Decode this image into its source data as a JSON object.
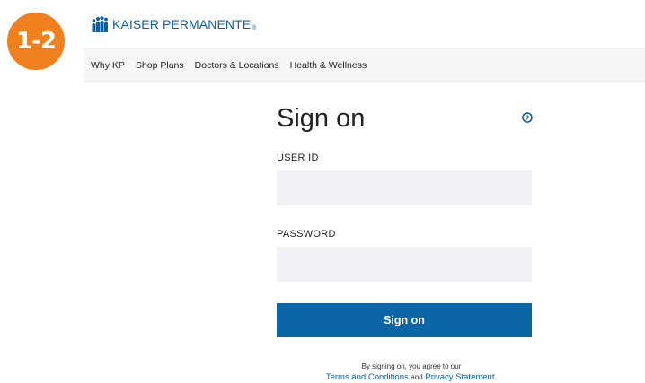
{
  "badge": {
    "step_label": "1-2"
  },
  "brand": {
    "name": "KAISER PERMANENTE",
    "registered_mark": "®",
    "color": "#0b5fa4"
  },
  "nav": {
    "items": [
      {
        "label": "Why KP"
      },
      {
        "label": "Shop Plans"
      },
      {
        "label": "Doctors & Locations"
      },
      {
        "label": "Health & Wellness"
      }
    ]
  },
  "signin": {
    "title": "Sign on",
    "help_icon": "question-circle-icon",
    "user_id_label": "USER ID",
    "user_id_value": "",
    "password_label": "PASSWORD",
    "password_value": "",
    "submit_label": "Sign on"
  },
  "legal": {
    "line1": "By signing on, you agree to our",
    "terms_link": "Terms and Conditions",
    "and_text": "and",
    "privacy_link": "Privacy Statement",
    "period": "."
  },
  "colors": {
    "accent": "#0b66a8",
    "badge": "#f07f1d",
    "input_bg": "#f2f2f4"
  }
}
